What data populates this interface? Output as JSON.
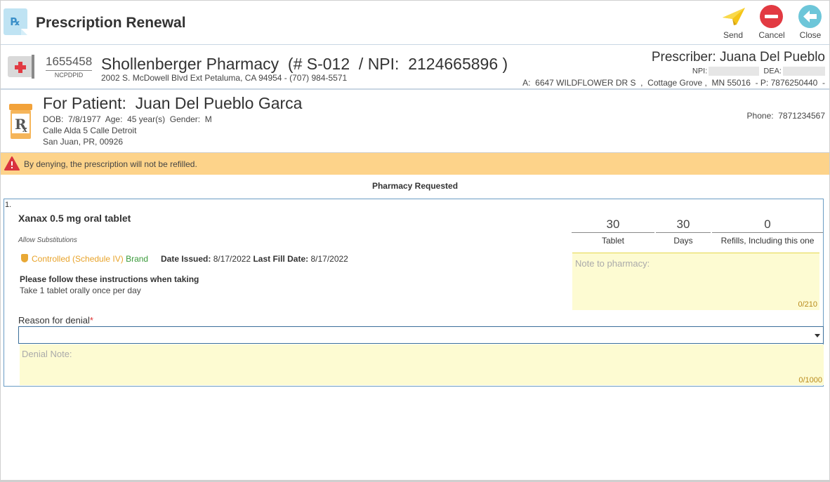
{
  "header": {
    "title": "Prescription Renewal",
    "app_icon": "prescription-rx-icon",
    "toolbar": [
      {
        "label": "Send",
        "icon": "paper-plane-icon"
      },
      {
        "label": "Cancel",
        "icon": "cancel-circle-icon"
      },
      {
        "label": "Close",
        "icon": "back-arrow-icon"
      }
    ]
  },
  "pharmacy": {
    "ncpdp_id": "1655458",
    "ncpdp_label": "NCPDPID",
    "name": "Shollenberger Pharmacy  (# S-012  / NPI:  2124665896 )",
    "address": "2002 S. McDowell Blvd Ext Petaluma, CA 94954 - (707) 984-5571",
    "icon": "pharmacy-cross-icon"
  },
  "prescriber": {
    "title": "Prescriber: Juana Del Pueblo",
    "npi_label": "NPI:",
    "dea_label": "DEA:",
    "address": "A:  6647 WILDFLOWER DR S  ,  Cottage Grove ,  MN 55016  - P: 7876250440  -"
  },
  "patient": {
    "title": "For Patient:  Juan Del Pueblo Garca",
    "demographics": "DOB:  7/8/1977  Age:  45 year(s)  Gender:  M",
    "address_line1": "Calle Alda 5 Calle Detroit",
    "address_line2": "San Juan, PR, 00926",
    "phone": "Phone:  7871234567",
    "icon": "rx-bottle-icon"
  },
  "warning": {
    "text": "By denying, the prescription will not be refilled.",
    "icon": "warning-triangle-icon",
    "color": "#fdd38a"
  },
  "section_title": "Pharmacy Requested",
  "medication": {
    "number": "1.",
    "name": "Xanax 0.5 mg oral tablet",
    "substitutions": "Allow Substitutions",
    "controlled": "Controlled (Schedule IV)",
    "brand": "Brand",
    "date_issued_label": "Date Issued:",
    "date_issued": "8/17/2022",
    "last_fill_label": "Last Fill Date:",
    "last_fill": "8/17/2022",
    "instructions_heading": "Please follow these instructions when taking",
    "instructions": "Take 1 tablet orally once per day",
    "quantity": "30",
    "quantity_unit": "Tablet",
    "days": "30",
    "days_label": "Days",
    "refills": "0",
    "refills_label": "Refills, Including this one",
    "note_placeholder": "Note to pharmacy:",
    "note_counter": "0/210"
  },
  "denial": {
    "label": "Reason for denial",
    "required_mark": "*",
    "selected": "",
    "note_placeholder": "Denial Note:",
    "note_counter": "0/1000"
  }
}
